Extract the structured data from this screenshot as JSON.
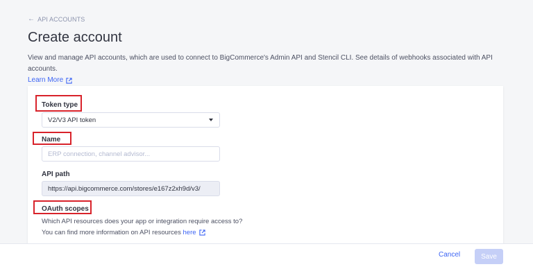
{
  "breadcrumb": {
    "arrow": "←",
    "label": "API ACCOUNTS"
  },
  "page": {
    "title": "Create account",
    "description": "View and manage API accounts, which are used to connect to BigCommerce's Admin API and Stencil CLI. See details of webhooks associated with API accounts.",
    "learn_more": "Learn More"
  },
  "form": {
    "token_type": {
      "label": "Token type",
      "value": "V2/V3 API token"
    },
    "name": {
      "label": "Name",
      "placeholder": "ERP connection, channel advisor..."
    },
    "api_path": {
      "label": "API path",
      "value": "https://api.bigcommerce.com/stores/e167z2xh9d/v3/"
    },
    "oauth_scopes": {
      "label": "OAuth scopes",
      "help_line1": "Which API resources does your app or integration require access to?",
      "help_line2": "You can find more information on API resources",
      "here_link": "here"
    }
  },
  "footer": {
    "cancel": "Cancel",
    "save": "Save"
  },
  "colors": {
    "accent": "#3c64f4",
    "highlight": "#d8222a",
    "save_disabled": "#c5cff7"
  }
}
